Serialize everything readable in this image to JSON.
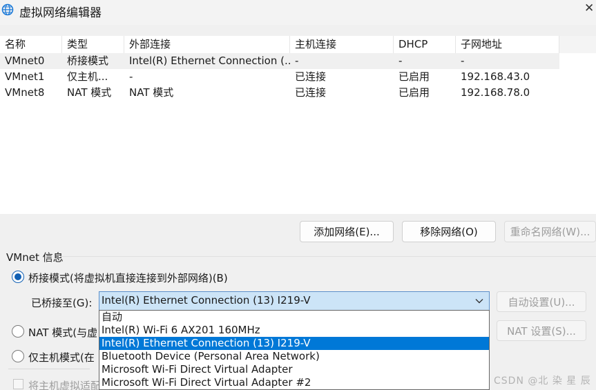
{
  "window": {
    "title": "虚拟网络编辑器",
    "app_icon": "globe-icon",
    "close_label": "✕"
  },
  "network_list": {
    "columns": [
      "名称",
      "类型",
      "外部连接",
      "主机连接",
      "DHCP",
      "子网地址"
    ],
    "rows": [
      [
        "VMnet0",
        "桥接模式",
        "Intel(R) Ethernet Connection (...",
        "-",
        "-",
        "-"
      ],
      [
        "VMnet1",
        "仅主机...",
        "-",
        "已连接",
        "已启用",
        "192.168.43.0"
      ],
      [
        "VMnet8",
        "NAT 模式",
        "NAT 模式",
        "已连接",
        "已启用",
        "192.168.78.0"
      ]
    ]
  },
  "actions": {
    "add_network": "添加网络(E)...",
    "remove_network": "移除网络(O)",
    "rename_network": "重命名网络(W)..."
  },
  "vmnet_info": {
    "section_title": "VMnet 信息",
    "bridged_option": "桥接模式(将虚拟机直接连接到外部网络)(B)",
    "bridged_to_label": "已桥接至(G):",
    "bridged_to_value": "Intel(R) Ethernet Connection (13) I219-V",
    "auto_settings": "自动设置(U)...",
    "nat_option": "NAT 模式(与虚",
    "nat_settings": "NAT 设置(S)...",
    "host_only_option": "仅主机模式(在",
    "connect_host_adapter": "将主机虚拟适配"
  },
  "bridge_dropdown": {
    "options": [
      "自动",
      "Intel(R) Wi-Fi 6 AX201 160MHz",
      "Intel(R) Ethernet Connection (13) I219-V",
      "Bluetooth Device (Personal Area Network)",
      "Microsoft Wi-Fi Direct Virtual Adapter",
      "Microsoft Wi-Fi Direct Virtual Adapter #2"
    ],
    "selected_index": 2
  },
  "watermark": "CSDN @北 染 星 辰",
  "colors": {
    "accent": "#0078d7",
    "combo_focus": "#cce4f7",
    "radio_checked": "#1160b4"
  }
}
